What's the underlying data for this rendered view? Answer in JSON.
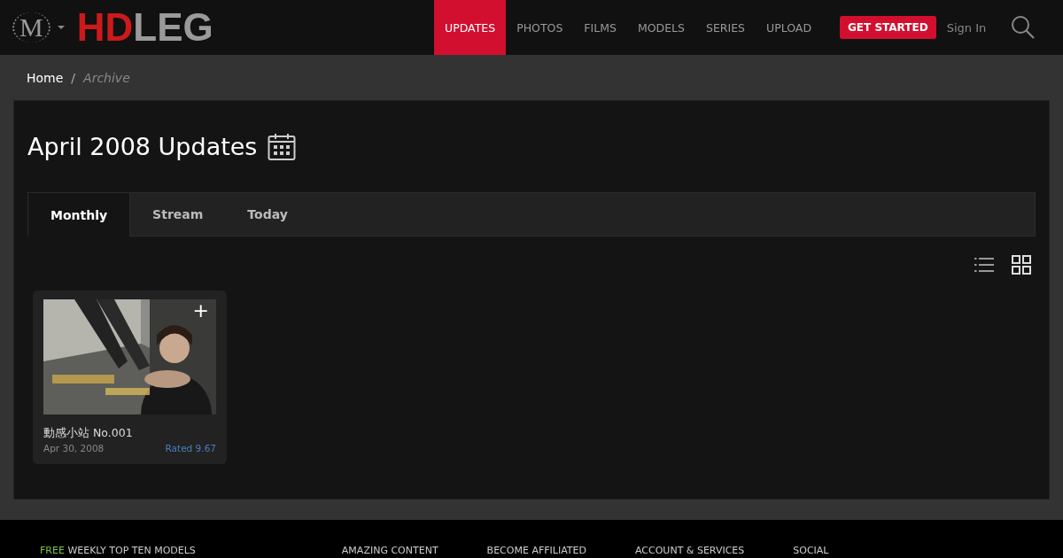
{
  "header": {
    "logo_mark": "M",
    "logo": [
      {
        "text": "HD",
        "color": "#cc1a1a"
      },
      {
        "text": "LEG",
        "color": "#9a9a9a"
      }
    ],
    "nav": [
      {
        "label": "UPDATES",
        "selected": true
      },
      {
        "label": "PHOTOS",
        "selected": false
      },
      {
        "label": "FILMS",
        "selected": false
      },
      {
        "label": "MODELS",
        "selected": false
      },
      {
        "label": "SERIES",
        "selected": false
      },
      {
        "label": "UPLOAD",
        "selected": false
      }
    ],
    "cta": "GET STARTED",
    "sign_in": "Sign In"
  },
  "breadcrumb": [
    "Home",
    "Archive"
  ],
  "breadcrumb_separator": "/",
  "title": "April 2008 Updates",
  "tabs": [
    {
      "label": "Monthly",
      "selected": true
    },
    {
      "label": "Stream",
      "selected": false
    },
    {
      "label": "Today",
      "selected": false
    }
  ],
  "view_modes": [
    {
      "kind": "list",
      "selected": false
    },
    {
      "kind": "grid",
      "selected": true
    }
  ],
  "cards": [
    {
      "kind": "picture",
      "add": "+",
      "title": "動感小站 No.001",
      "date": "Apr 30, 2008",
      "rating": "Rated 9.67"
    }
  ],
  "footer": {
    "headings": [
      {
        "accent": "FREE",
        "text": "WEEKLY TOP TEN MODELS"
      },
      {
        "text": "AMAZING CONTENT"
      },
      {
        "text": "BECOME AFFILIATED"
      },
      {
        "text": "ACCOUNT & SERVICES"
      },
      {
        "text": "SOCIAL"
      }
    ]
  }
}
